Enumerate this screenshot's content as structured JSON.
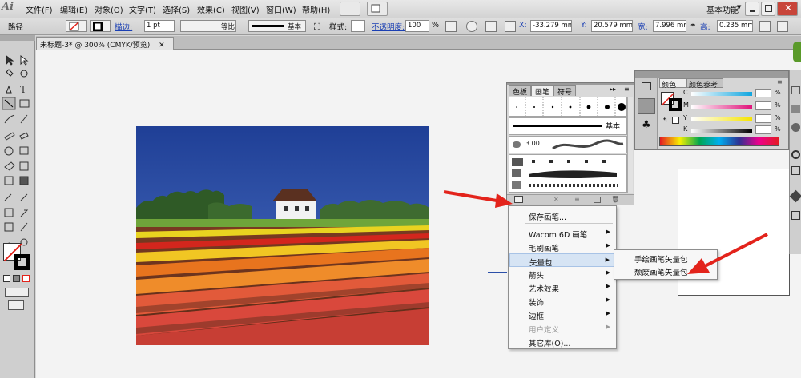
{
  "app": {
    "logo": "Ai"
  },
  "menu": [
    "文件(F)",
    "编辑(E)",
    "对象(O)",
    "文字(T)",
    "选择(S)",
    "效果(C)",
    "视图(V)",
    "窗口(W)",
    "帮助(H)"
  ],
  "workspace": {
    "label": "基本功能",
    "search_placeholder": ""
  },
  "control": {
    "path_label": "路径",
    "stroke_label": "描边:",
    "stroke_value": "1 pt",
    "profile_label": "等比",
    "brush_label": "基本",
    "style_label": "样式:",
    "opacity_label": "不透明度:",
    "opacity_value": "100",
    "opacity_unit": "%",
    "x_label": "X:",
    "x_value": "-33.279 mm",
    "y_label": "Y:",
    "y_value": "20.579 mm",
    "w_label": "宽:",
    "w_value": "7.996 mm",
    "h_label": "高:",
    "h_value": "0.235 mm"
  },
  "document": {
    "tab_title": "未标题-3* @ 300% (CMYK/预览)"
  },
  "brush_panel": {
    "tabs": [
      "色板",
      "画笔",
      "符号"
    ],
    "active_tab": "画笔",
    "basic_brush": "基本",
    "brush_size": "3.00"
  },
  "color_panel": {
    "tabs": [
      "颜色",
      "颜色参考"
    ],
    "channels": [
      {
        "label": "C",
        "unit": "%"
      },
      {
        "label": "M",
        "unit": "%"
      },
      {
        "label": "Y",
        "unit": "%"
      },
      {
        "label": "K",
        "unit": "%"
      }
    ]
  },
  "context_menu": {
    "items": [
      {
        "label": "保存画笔...",
        "submenu": false,
        "disabled": false
      },
      {
        "label": "Wacom 6D 画笔",
        "submenu": true,
        "disabled": false
      },
      {
        "label": "毛刷画笔",
        "submenu": true,
        "disabled": false
      },
      {
        "label": "矢量包",
        "submenu": true,
        "disabled": false,
        "highlighted": true
      },
      {
        "label": "箭头",
        "submenu": true,
        "disabled": false
      },
      {
        "label": "艺术效果",
        "submenu": true,
        "disabled": false
      },
      {
        "label": "装饰",
        "submenu": true,
        "disabled": false
      },
      {
        "label": "边框",
        "submenu": true,
        "disabled": false
      },
      {
        "label": "用户定义",
        "submenu": true,
        "disabled": true
      },
      {
        "label": "其它库(O)...",
        "submenu": false,
        "disabled": false
      }
    ],
    "submenu": [
      "手绘画笔矢量包",
      "颓废画笔矢量包"
    ]
  },
  "colors": {
    "accent_red": "#e3231b",
    "highlight": "#d6e4f4",
    "sky": "#2b4fa8"
  }
}
